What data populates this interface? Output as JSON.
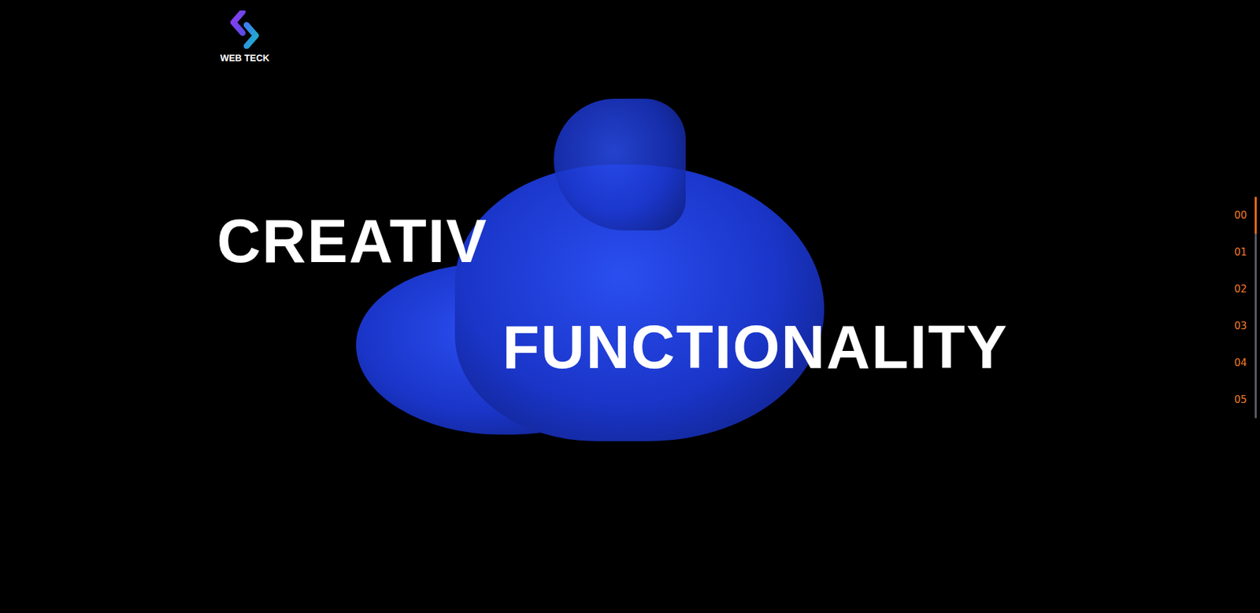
{
  "logo": {
    "text": "WEB TECK"
  },
  "hero": {
    "lines": [
      "CREATIV",
      "FUNCTIONALITY"
    ]
  },
  "nav": {
    "items": [
      {
        "label": "00",
        "selected": true
      },
      {
        "label": "01",
        "selected": false
      },
      {
        "label": "02",
        "selected": false
      },
      {
        "label": "03",
        "selected": false
      },
      {
        "label": "04",
        "selected": false
      },
      {
        "label": "05",
        "selected": false
      }
    ]
  }
}
